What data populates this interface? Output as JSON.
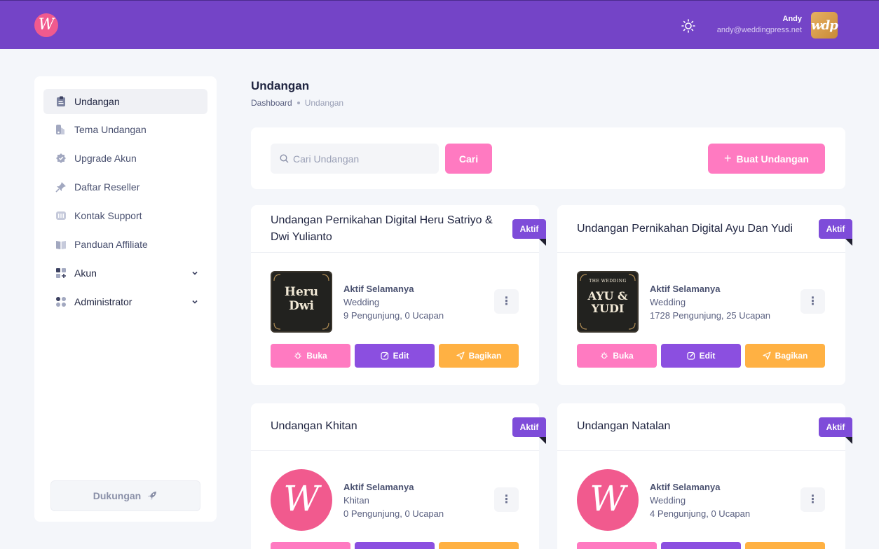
{
  "header": {
    "logo_letter": "W",
    "theme_icon": "sun-icon",
    "user_name": "Andy",
    "user_email": "andy@weddingpress.net",
    "avatar_text": "wdp"
  },
  "sidebar": {
    "items": [
      {
        "label": "Undangan",
        "icon": "invitation-icon"
      },
      {
        "label": "Tema Undangan",
        "icon": "theme-icon"
      },
      {
        "label": "Upgrade Akun",
        "icon": "badge-icon"
      },
      {
        "label": "Daftar Reseller",
        "icon": "pin-icon"
      },
      {
        "label": "Kontak Support",
        "icon": "support-icon"
      },
      {
        "label": "Panduan Affiliate",
        "icon": "book-icon"
      },
      {
        "label": "Akun",
        "icon": "apps-add-icon"
      },
      {
        "label": "Administrator",
        "icon": "grid-dots-icon"
      }
    ],
    "support_label": "Dukungan"
  },
  "page": {
    "title": "Undangan",
    "breadcrumb_home": "Dashboard",
    "breadcrumb_current": "Undangan"
  },
  "toolbar": {
    "search_placeholder": "Cari Undangan",
    "search_button": "Cari",
    "create_button": "Buat Undangan"
  },
  "cards": [
    {
      "title": "Undangan Pernikahan Digital Heru Satriyo & Dwi Yulianto",
      "badge": "Aktif",
      "status": "Aktif Selamanya",
      "category": "Wedding",
      "stats": "9 Pengunjung, 0 Ucapan",
      "thumb_line1": "Heru",
      "thumb_line2": "Dwi",
      "buttons": {
        "open": "Buka",
        "edit": "Edit",
        "share": "Bagikan"
      }
    },
    {
      "title": "Undangan Pernikahan Digital Ayu Dan Yudi",
      "badge": "Aktif",
      "status": "Aktif Selamanya",
      "category": "Wedding",
      "stats": "1728 Pengunjung, 25 Ucapan",
      "thumb_top": "THE WEDDING",
      "thumb_line1": "AYU &",
      "thumb_line2": "YUDI",
      "buttons": {
        "open": "Buka",
        "edit": "Edit",
        "share": "Bagikan"
      }
    },
    {
      "title": "Undangan Khitan",
      "badge": "Aktif",
      "status": "Aktif Selamanya",
      "category": "Khitan",
      "stats": "0 Pengunjung, 0 Ucapan",
      "thumb_letter": "W"
    },
    {
      "title": "Undangan Natalan",
      "badge": "Aktif",
      "status": "Aktif Selamanya",
      "category": "Wedding",
      "stats": "4 Pengunjung, 0 Ucapan",
      "thumb_letter": "W"
    }
  ],
  "colors": {
    "header": "#7444c7",
    "pink": "#ff7ac1",
    "purple": "#8b4fe0",
    "orange": "#ffb143",
    "badge": "#7e4cd9"
  }
}
